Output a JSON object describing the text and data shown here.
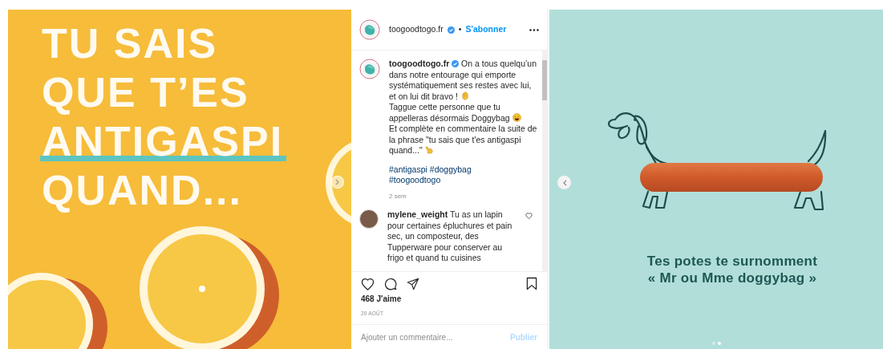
{
  "post_image": {
    "lines": [
      {
        "text": "TU SAIS",
        "underlined": false
      },
      {
        "text": "QUE T’ES",
        "underlined": false
      },
      {
        "text": "ANTIGASPI",
        "underlined": true
      },
      {
        "text": "QUAND...",
        "underlined": false
      }
    ]
  },
  "post": {
    "header": {
      "username": "toogoodtogo.fr",
      "verified": true,
      "separator": "•",
      "follow_label": "S'abonner"
    },
    "caption": {
      "username": "toogoodtogo.fr",
      "verified": true,
      "parts": [
        "On a tous quelqu’un dans notre entourage qui emporte systématiquement ses restes avec lui, et on lui dit bravo !",
        "Taggue cette personne que tu appelleras désormais Doggybag",
        "Et complète en commentaire la suite de la phrase \"tu sais que t'es antigaspi quand...\""
      ],
      "hashtags": [
        "#antigaspi",
        "#doggybag",
        "#toogoodtogo"
      ],
      "time": "2 sem"
    },
    "comments": [
      {
        "username": "mylene_weight",
        "text": "Tu as un lapin pour certaines épluchures et pain sec, un composteur, des Tupperware pour conserver au frigo et quand tu cuisines"
      }
    ],
    "likes": "468 J'aime",
    "date": "20 AOÛT",
    "comment_placeholder": "Ajouter un commentaire...",
    "publish_label": "Publier"
  },
  "next_slide": {
    "caption_lines": [
      "Tes potes te surnomment",
      "« Mr ou Mme doggybag »"
    ],
    "dots": [
      {
        "selected": false
      },
      {
        "selected": true
      }
    ]
  }
}
